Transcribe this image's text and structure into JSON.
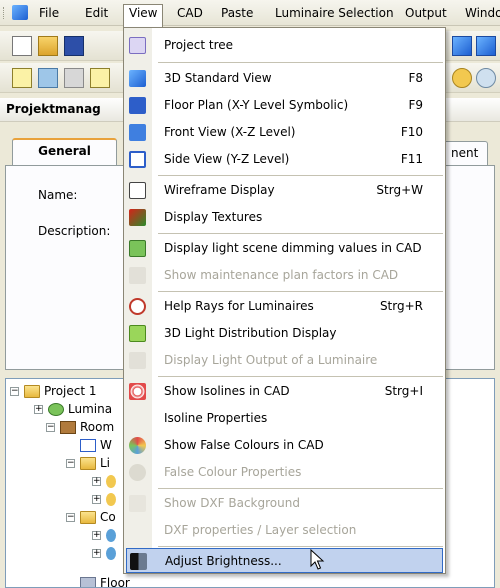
{
  "menubar": {
    "items": [
      "File",
      "Edit",
      "View",
      "CAD",
      "Paste",
      "Luminaire Selection",
      "Output",
      "Windo"
    ]
  },
  "panel": {
    "title": "Projektmanag",
    "tabs": [
      "General",
      "nent"
    ],
    "name_label": "Name:",
    "description_label": "Description:"
  },
  "tree": {
    "items": [
      "Project 1",
      "Lumina",
      "Room",
      "W",
      "Li",
      "Co",
      "Floor"
    ]
  },
  "view_menu": {
    "items": [
      {
        "label": "Project tree",
        "shortcut": "",
        "icon": "project-tree-icon",
        "enabled": true
      },
      {
        "label": "3D Standard View",
        "shortcut": "F8",
        "icon": "3d-view-icon",
        "enabled": true
      },
      {
        "label": "Floor Plan (X-Y Level Symbolic)",
        "shortcut": "F9",
        "icon": "floor-plan-icon",
        "enabled": true
      },
      {
        "label": "Front View (X-Z Level)",
        "shortcut": "F10",
        "icon": "front-view-icon",
        "enabled": true
      },
      {
        "label": "Side View (Y-Z Level)",
        "shortcut": "F11",
        "icon": "side-view-icon",
        "enabled": true
      },
      {
        "label": "Wireframe Display",
        "shortcut": "Strg+W",
        "icon": "wireframe-icon",
        "enabled": true
      },
      {
        "label": "Display Textures",
        "shortcut": "",
        "icon": "textures-icon",
        "enabled": true
      },
      {
        "label": "Display light scene dimming values in CAD",
        "shortcut": "",
        "icon": "dimming-icon",
        "enabled": true
      },
      {
        "label": "Show maintenance plan factors in CAD",
        "shortcut": "",
        "icon": "maintenance-icon",
        "enabled": false
      },
      {
        "label": "Help Rays for Luminaires",
        "shortcut": "Strg+R",
        "icon": "help-rays-icon",
        "enabled": true
      },
      {
        "label": "3D Light Distribution Display",
        "shortcut": "",
        "icon": "light-distribution-icon",
        "enabled": true
      },
      {
        "label": "Display Light Output of a Luminaire",
        "shortcut": "",
        "icon": "light-output-icon",
        "enabled": false
      },
      {
        "label": "Show Isolines in CAD",
        "shortcut": "Strg+I",
        "icon": "isolines-icon",
        "enabled": true
      },
      {
        "label": "Isoline Properties",
        "shortcut": "",
        "icon": "",
        "enabled": true
      },
      {
        "label": "Show False Colours in CAD",
        "shortcut": "",
        "icon": "false-colours-icon",
        "enabled": true
      },
      {
        "label": "False Colour Properties",
        "shortcut": "",
        "icon": "false-colour-props-icon",
        "enabled": false
      },
      {
        "label": "Show DXF Background",
        "shortcut": "",
        "icon": "dxf-background-icon",
        "enabled": false
      },
      {
        "label": "DXF properties / Layer selection",
        "shortcut": "",
        "icon": "",
        "enabled": false
      },
      {
        "label": "Adjust Brightness...",
        "shortcut": "",
        "icon": "brightness-icon",
        "enabled": true,
        "highlighted": true
      }
    ]
  }
}
